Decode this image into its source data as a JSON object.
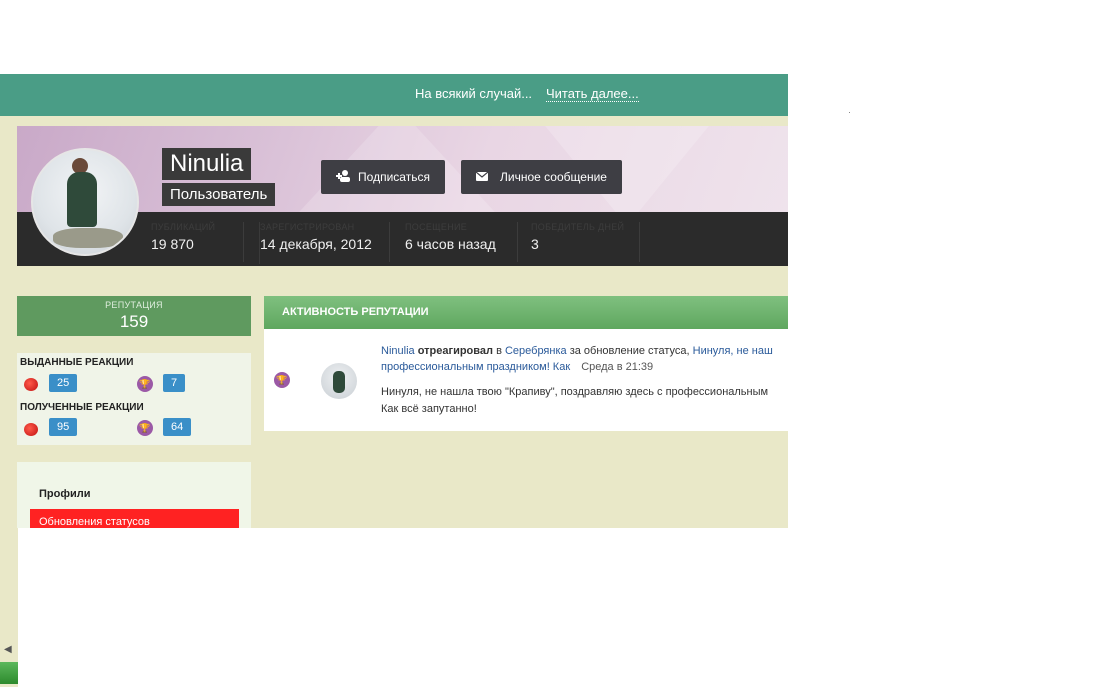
{
  "topbar": {
    "notice": "На всякий случай...",
    "read_more": "Читать далее..."
  },
  "profile": {
    "name": "Ninulia",
    "role": "Пользователь",
    "follow_label": "Подписаться",
    "message_label": "Личное сообщение",
    "stats": [
      {
        "label": "Публикаций",
        "value": "19 870"
      },
      {
        "label": "Зарегистрирован",
        "value": "14 декабря, 2012"
      },
      {
        "label": "Посещение",
        "value": "6 часов назад"
      },
      {
        "label": "Победитель дней",
        "value": "3"
      }
    ]
  },
  "reputation": {
    "label": "РЕПУТАЦИЯ",
    "value": "159"
  },
  "reactions": {
    "given_title": "ВЫДАННЫЕ РЕАКЦИИ",
    "given_like": "25",
    "given_trophy": "7",
    "received_title": "ПОЛУЧЕННЫЕ РЕАКЦИИ",
    "received_like": "95",
    "received_trophy": "64"
  },
  "profiles_menu": {
    "title": "Профили",
    "active_item": "Обновления статусов"
  },
  "activity": {
    "title": "АКТИВНОСТЬ РЕПУТАЦИИ",
    "actor": "Ninulia",
    "action": "отреагировал",
    "in_word": "в",
    "target_user": "Серебрянка",
    "for_text": "за обновление статуса,",
    "status_link_1": "Нинуля, не наш",
    "status_link_2": "профессиональным праздником! Как",
    "time": "Среда в 21:39",
    "body_1": "Нинуля, не нашла твою \"Крапиву\", поздравляю здесь с профессиональным",
    "body_2": "Как всё запутанно!"
  },
  "colors": {
    "topbar": "#4a9d86",
    "page_bg": "#e9e8c8",
    "reputation": "#5f9a5f",
    "count_badge": "#3a8fc8",
    "active_item": "#ff2222"
  },
  "icons": {
    "follow": "user-plus-icon",
    "message": "envelope-icon",
    "like": "tomato-icon",
    "trophy": "trophy-icon"
  }
}
